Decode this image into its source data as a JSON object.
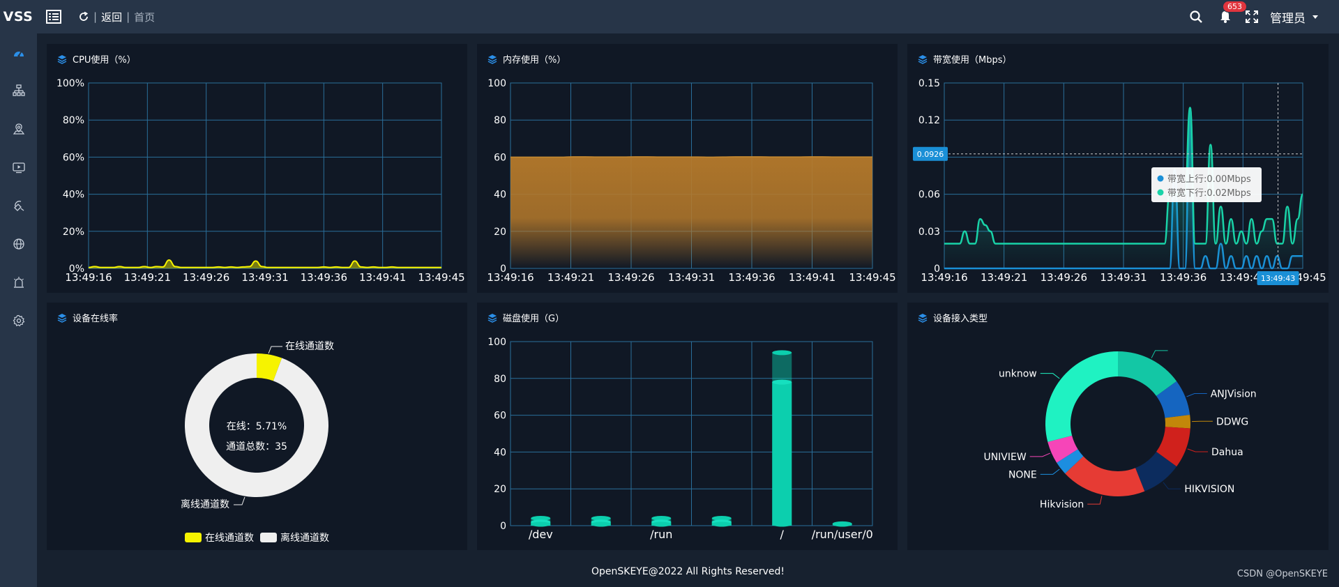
{
  "header": {
    "logo": "VSS",
    "back_label": "返回",
    "breadcrumb": "首页",
    "notification_count": "653",
    "user": "管理员",
    "separator": "|"
  },
  "sidebar": {
    "items": [
      "dashboard-icon",
      "device-tree-icon",
      "location-icon",
      "video-icon",
      "alarm-config-icon",
      "globe-icon",
      "siren-icon",
      "gear-icon"
    ]
  },
  "colors": {
    "cpu": "#f6f300",
    "memory": "#b67a2b",
    "upload": "#1a8fd6",
    "download": "#19d3a8",
    "disk": "#0ccfae",
    "grid": "#2a6f9b",
    "online": "#f6f300",
    "offline": "#efefef"
  },
  "panels": {
    "cpu": {
      "title": "CPU使用（%）"
    },
    "memory": {
      "title": "内存使用（%）"
    },
    "bandwidth": {
      "title": "带宽使用（Mbps）"
    },
    "online": {
      "title": "设备在线率"
    },
    "disk": {
      "title": "磁盘使用（G）"
    },
    "access": {
      "title": "设备接入类型"
    }
  },
  "chart_data": [
    {
      "id": "cpu",
      "type": "area",
      "x": [
        "13:49:16",
        "13:49:21",
        "13:49:26",
        "13:49:31",
        "13:49:36",
        "13:49:41",
        "13:49:45"
      ],
      "yticks": [
        "0%",
        "20%",
        "40%",
        "60%",
        "80%",
        "100%"
      ],
      "ylim": [
        0,
        100
      ],
      "series": [
        {
          "values": [
            0.5,
            1,
            0.5,
            0.5,
            0.5,
            1,
            0.5,
            0.5,
            0.5,
            1,
            0.5,
            1,
            0.8,
            4.5,
            1,
            0.5,
            0.5,
            0.5,
            0.5,
            0.5,
            0.5,
            0.8,
            0.5,
            0.8,
            0.5,
            0.8,
            1,
            4,
            1,
            0.5,
            0.5,
            0.5,
            0.5,
            0.5,
            0.5,
            0.5,
            0.5,
            0.5,
            0.8,
            0.5,
            0.8,
            0.5,
            0.5,
            4,
            0.8,
            0.5,
            0.8,
            0.5,
            0.5,
            0.8,
            0.5,
            0.5,
            0.5,
            0.5,
            0.5,
            0.5,
            0.5,
            0.5
          ]
        }
      ]
    },
    {
      "id": "memory",
      "type": "area",
      "x": [
        "13:49:16",
        "13:49:21",
        "13:49:26",
        "13:49:31",
        "13:49:36",
        "13:49:41",
        "13:49:45"
      ],
      "yticks": [
        "0",
        "20",
        "40",
        "60",
        "80",
        "100"
      ],
      "ylim": [
        0,
        100
      ],
      "series": [
        {
          "values": [
            60,
            60,
            60,
            60,
            60,
            60.2,
            60.2,
            60.1,
            60.1,
            60.1,
            60.2,
            60.2,
            60.1,
            60.1,
            60.1,
            60.1,
            60,
            60.1,
            60.2,
            60.2,
            60.2,
            60.1,
            60.1,
            60.1,
            60.2,
            60.2,
            60.1,
            60.1,
            60.1,
            60.1
          ]
        }
      ]
    },
    {
      "id": "bandwidth",
      "type": "line",
      "x": [
        "13:49:16",
        "13:49:21",
        "13:49:26",
        "13:49:31",
        "13:49:36",
        "13:49:41",
        "13:49:45"
      ],
      "yticks": [
        "0",
        "0.03",
        "0.06",
        "0.09",
        "0.12",
        "0.15"
      ],
      "ylim": [
        0,
        0.15
      ],
      "pointer_value": "0.0926",
      "pointer_time": "13:49:43",
      "tooltip": [
        "带宽上行:0.00Mbps",
        "带宽下行:0.02Mbps"
      ],
      "series": [
        {
          "name": "带宽上行",
          "values": [
            0,
            0,
            0,
            0,
            0,
            0,
            0,
            0,
            0,
            0,
            0,
            0,
            0,
            0,
            0,
            0,
            0,
            0,
            0,
            0,
            0,
            0,
            0,
            0,
            0,
            0,
            0,
            0,
            0,
            0,
            0,
            0,
            0,
            0,
            0,
            0,
            0,
            0,
            0,
            0,
            0,
            0,
            0,
            0,
            0,
            0.08,
            0,
            0,
            0.13,
            0,
            0,
            0.01,
            0,
            0,
            0.02,
            0,
            0.01,
            0,
            0,
            0.01,
            0,
            0.01,
            0,
            0.01,
            0,
            0.01,
            0,
            0,
            0.01,
            0.01,
            0.01
          ]
        },
        {
          "name": "带宽下行",
          "values": [
            0.02,
            0.02,
            0.02,
            0.02,
            0.03,
            0.02,
            0.02,
            0.04,
            0.035,
            0.03,
            0.02,
            0.02,
            0.02,
            0.02,
            0.02,
            0.02,
            0.02,
            0.02,
            0.02,
            0.02,
            0.02,
            0.02,
            0.02,
            0.02,
            0.02,
            0.02,
            0.02,
            0.02,
            0.02,
            0.02,
            0.02,
            0.02,
            0.02,
            0.02,
            0.02,
            0.02,
            0.02,
            0.02,
            0.02,
            0.02,
            0.02,
            0.02,
            0.02,
            0.02,
            0.06,
            0.06,
            0.06,
            0.06,
            0.13,
            0.02,
            0.02,
            0.02,
            0.1,
            0.02,
            0.05,
            0.02,
            0.04,
            0.02,
            0.03,
            0.02,
            0.04,
            0.02,
            0.03,
            0.04,
            0.04,
            0.02,
            0.02,
            0.05,
            0.02,
            0.04,
            0.06
          ]
        }
      ]
    },
    {
      "id": "online",
      "type": "pie",
      "center_lines": [
        "在线：5.71%",
        "通道总数：35"
      ],
      "legend": [
        "在线通道数",
        "离线通道数"
      ],
      "slices": [
        {
          "label": "在线通道数",
          "value": 5.71,
          "color": "#f6f300"
        },
        {
          "label": "离线通道数",
          "value": 94.29,
          "color": "#efefef"
        }
      ]
    },
    {
      "id": "disk",
      "type": "bar",
      "categories": [
        "/dev",
        "",
        "/run",
        "",
        "/",
        "/run/user/0"
      ],
      "yticks": [
        "0",
        "20",
        "40",
        "60",
        "80",
        "100"
      ],
      "ylim": [
        0,
        100
      ],
      "series": [
        {
          "name": "used",
          "values": [
            2,
            2,
            2,
            2,
            78,
            0
          ]
        },
        {
          "name": "total",
          "values": [
            4,
            4,
            4,
            4,
            94,
            1
          ]
        }
      ]
    },
    {
      "id": "access",
      "type": "pie",
      "slices": [
        {
          "label": "",
          "value": 15,
          "color": "#13c7a5"
        },
        {
          "label": "ANJVision",
          "value": 8,
          "color": "#1565c0"
        },
        {
          "label": "DDWG",
          "value": 3,
          "color": "#c2870a"
        },
        {
          "label": "Dahua",
          "value": 9,
          "color": "#d0211c"
        },
        {
          "label": "HIKVISION",
          "value": 9,
          "color": "#0c2c5e"
        },
        {
          "label": "Hikvision",
          "value": 19,
          "color": "#e63b34"
        },
        {
          "label": "NONE",
          "value": 3,
          "color": "#1c8ee0"
        },
        {
          "label": "UNIVIEW",
          "value": 5,
          "color": "#f645b8"
        },
        {
          "label": "unknow",
          "value": 29,
          "color": "#1ff2c2"
        }
      ]
    }
  ],
  "footer": "OpenSKEYE@2022 All Rights Reserved!",
  "watermark": "CSDN @OpenSKEYE"
}
